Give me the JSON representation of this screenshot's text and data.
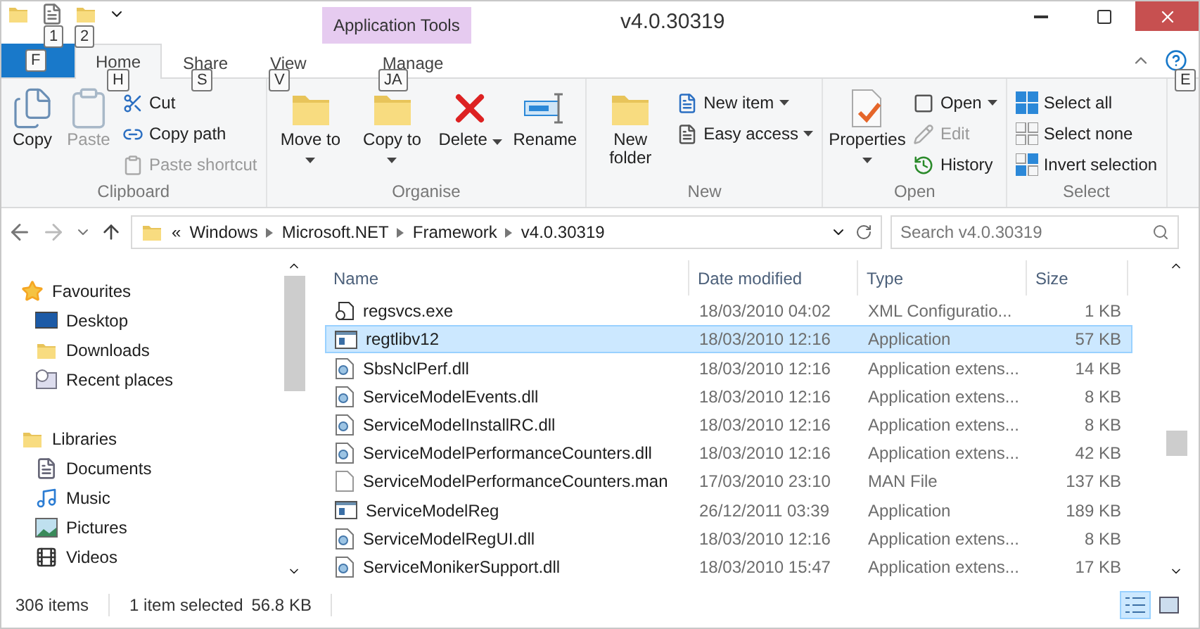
{
  "window": {
    "title": "v4.0.30319"
  },
  "quick_access": {
    "keytips": [
      "1",
      "2"
    ]
  },
  "contextual_tab": {
    "label": "Application Tools"
  },
  "file_tab": {
    "keytip": "F"
  },
  "tabs": [
    {
      "label": "Home",
      "selected": true,
      "keytip": "H"
    },
    {
      "label": "Share",
      "selected": false,
      "keytip": "S"
    },
    {
      "label": "View",
      "selected": false,
      "keytip": "V"
    },
    {
      "label": "Manage",
      "selected": false,
      "keytip": "JA"
    }
  ],
  "help_keytip": "E",
  "ribbon": [
    {
      "label": "Clipboard",
      "items": [
        {
          "kind": "large",
          "label": "Copy",
          "disabled": false,
          "dropdown": false
        },
        {
          "kind": "large",
          "label": "Paste",
          "disabled": true,
          "dropdown": false
        },
        {
          "kind": "small",
          "label": "Cut",
          "disabled": false,
          "dropdown": false
        },
        {
          "kind": "small",
          "label": "Copy path",
          "disabled": false,
          "dropdown": false
        },
        {
          "kind": "small",
          "label": "Paste shortcut",
          "disabled": true,
          "dropdown": false
        }
      ]
    },
    {
      "label": "Organise",
      "items": [
        {
          "kind": "large",
          "label": "Move to",
          "disabled": false,
          "dropdown": true
        },
        {
          "kind": "large",
          "label": "Copy to",
          "disabled": false,
          "dropdown": true
        },
        {
          "kind": "large",
          "label": "Delete",
          "disabled": false,
          "dropdown": true
        },
        {
          "kind": "large",
          "label": "Rename",
          "disabled": false,
          "dropdown": false
        }
      ]
    },
    {
      "label": "New",
      "items": [
        {
          "kind": "large",
          "label": "New folder",
          "disabled": false,
          "dropdown": false
        },
        {
          "kind": "small",
          "label": "New item",
          "disabled": false,
          "dropdown": true
        },
        {
          "kind": "small",
          "label": "Easy access",
          "disabled": false,
          "dropdown": true
        }
      ]
    },
    {
      "label": "Open",
      "items": [
        {
          "kind": "large",
          "label": "Properties",
          "disabled": false,
          "dropdown": true
        },
        {
          "kind": "small",
          "label": "Open",
          "disabled": false,
          "dropdown": true
        },
        {
          "kind": "small",
          "label": "Edit",
          "disabled": true,
          "dropdown": false
        },
        {
          "kind": "small",
          "label": "History",
          "disabled": false,
          "dropdown": false
        }
      ]
    },
    {
      "label": "Select",
      "items": [
        {
          "kind": "small",
          "label": "Select all",
          "disabled": false,
          "dropdown": false
        },
        {
          "kind": "small",
          "label": "Select none",
          "disabled": false,
          "dropdown": false
        },
        {
          "kind": "small",
          "label": "Invert selection",
          "disabled": false,
          "dropdown": false
        }
      ]
    }
  ],
  "address": {
    "overflow": "«",
    "crumbs": [
      "Windows",
      "Microsoft.NET",
      "Framework",
      "v4.0.30319"
    ]
  },
  "search": {
    "placeholder": "Search v4.0.30319"
  },
  "navigation": [
    {
      "label": "Favourites",
      "children": [
        {
          "label": "Desktop"
        },
        {
          "label": "Downloads"
        },
        {
          "label": "Recent places"
        }
      ]
    },
    {
      "label": "Libraries",
      "children": [
        {
          "label": "Documents"
        },
        {
          "label": "Music"
        },
        {
          "label": "Pictures"
        },
        {
          "label": "Videos"
        }
      ]
    }
  ],
  "table": {
    "columns": [
      "Name",
      "Date modified",
      "Type",
      "Size"
    ],
    "rows": [
      {
        "kind": "config",
        "selected": false,
        "cells": [
          "regsvcs.exe",
          "18/03/2010 04:02",
          "XML Configuratio...",
          "1 KB"
        ]
      },
      {
        "kind": "app",
        "selected": true,
        "cells": [
          "regtlibv12",
          "18/03/2010 12:16",
          "Application",
          "57 KB"
        ]
      },
      {
        "kind": "dll",
        "selected": false,
        "cells": [
          "SbsNclPerf.dll",
          "18/03/2010 12:16",
          "Application extens...",
          "14 KB"
        ]
      },
      {
        "kind": "dll",
        "selected": false,
        "cells": [
          "ServiceModelEvents.dll",
          "18/03/2010 12:16",
          "Application extens...",
          "8 KB"
        ]
      },
      {
        "kind": "dll",
        "selected": false,
        "cells": [
          "ServiceModelInstallRC.dll",
          "18/03/2010 12:16",
          "Application extens...",
          "8 KB"
        ]
      },
      {
        "kind": "dll",
        "selected": false,
        "cells": [
          "ServiceModelPerformanceCounters.dll",
          "18/03/2010 12:16",
          "Application extens...",
          "42 KB"
        ]
      },
      {
        "kind": "file",
        "selected": false,
        "cells": [
          "ServiceModelPerformanceCounters.man",
          "17/03/2010 23:10",
          "MAN File",
          "137 KB"
        ]
      },
      {
        "kind": "app",
        "selected": false,
        "cells": [
          "ServiceModelReg",
          "26/12/2011 03:39",
          "Application",
          "189 KB"
        ]
      },
      {
        "kind": "dll",
        "selected": false,
        "cells": [
          "ServiceModelRegUI.dll",
          "18/03/2010 12:16",
          "Application extens...",
          "8 KB"
        ]
      },
      {
        "kind": "dll",
        "selected": false,
        "cells": [
          "ServiceMonikerSupport.dll",
          "18/03/2010 15:47",
          "Application extens...",
          "17 KB"
        ]
      }
    ]
  },
  "status_bar": {
    "count": "306 items",
    "selection": "1 item selected",
    "size": "56.8 KB"
  },
  "views": [
    {
      "kind": "details",
      "selected": true
    },
    {
      "kind": "large-icons",
      "selected": false
    }
  ]
}
